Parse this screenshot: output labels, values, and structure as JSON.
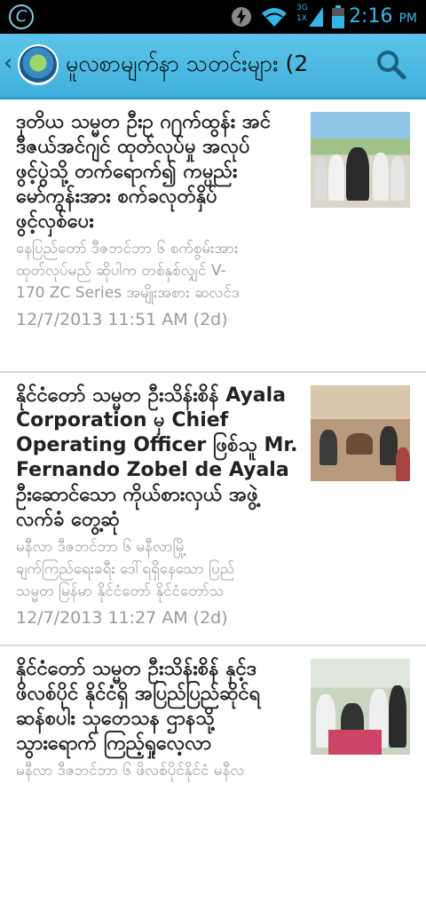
{
  "status_bar": {
    "time": "2:16",
    "ampm": "PM",
    "network_label": "3G",
    "signal_sub": "1X",
    "icons": [
      "app-icon",
      "lightning-icon",
      "wifi-icon",
      "signal-icon",
      "battery-icon"
    ]
  },
  "action_bar": {
    "back_glyph": "‹",
    "title": "မူလစာမျက်နာ သတင်းများ (2",
    "icons": [
      "back-icon",
      "app-logo-icon",
      "search-icon"
    ]
  },
  "articles": [
    {
      "headline": "ဒုတိယ သမ္မတ ဦးဥ ဂ႐က်ထွန်း အင်\nဒီဇယ်အင်ဂျင် ထုတ်လုပ်မှု အလုပ်\nဖွင့်ပွဲသို့ တက်ရောက်၍ ကမ္ပည်း\nမော်ကွန်းအား စက်ခလုတ်နှိပ်\nဖွင့်လှစ်ပေး",
      "summary": "နေပြည်တော် ဒီဇဘင်ဘာ ၆ စက်စွမ်းအား\nထုတ်လုပ်မည် ဆိုပါက တစ်နှစ်လျှင် V-\n170 ZC  Series  အမျိုးအစား ဆလင်ဒ",
      "date": "12/7/2013 11:51 AM (2d)"
    },
    {
      "headline": "နိုင်ငံတော် သမ္မတ ဦးသိန်းစိန် Ayala\nCorporation မှ Chief\nOperating Officer ဖြစ်သူ Mr.\nFernando Zobel de Ayala\nဦးဆောင်သော ကိုယ်စားလှယ် အဖွဲ့\nလက်ခံ တွေ့ဆုံ",
      "summary": "မနီလာ ဒီဇဘင်ဘာ ၆ မနီလာမြို့\nချက်ကြည်ရေးခရီး ဒေါ်ရရှိနေသော ပြည်\nသမ္မတ မြန်မာ နိုင်ငံတော် နိုင်ငံတော်သ",
      "date": "12/7/2013 11:27 AM (2d)"
    },
    {
      "headline": "နိုင်ငံတော် သမ္မတ ဦးသိန်းစိန် နှင့်ဒ\nဖိလစ်ပိုင် နိုင်ငံရှိ အပြည်ပြည်ဆိုင်ရ\nဆန်စပါး သုတေသန ဌာနသို့\nသွားရောက် ကြည့်ရှုလေ့လာ",
      "summary": "မနီလာ ဒီဇဘင်ဘာ ၆ ဖိလစ်ပိုင်နိုင်ငံ မနီလ",
      "date": ""
    }
  ],
  "colors": {
    "action_bar": "#4dbde6",
    "status_text": "#33b5e5",
    "headline": "#222222",
    "secondary": "#9a9a9a"
  }
}
